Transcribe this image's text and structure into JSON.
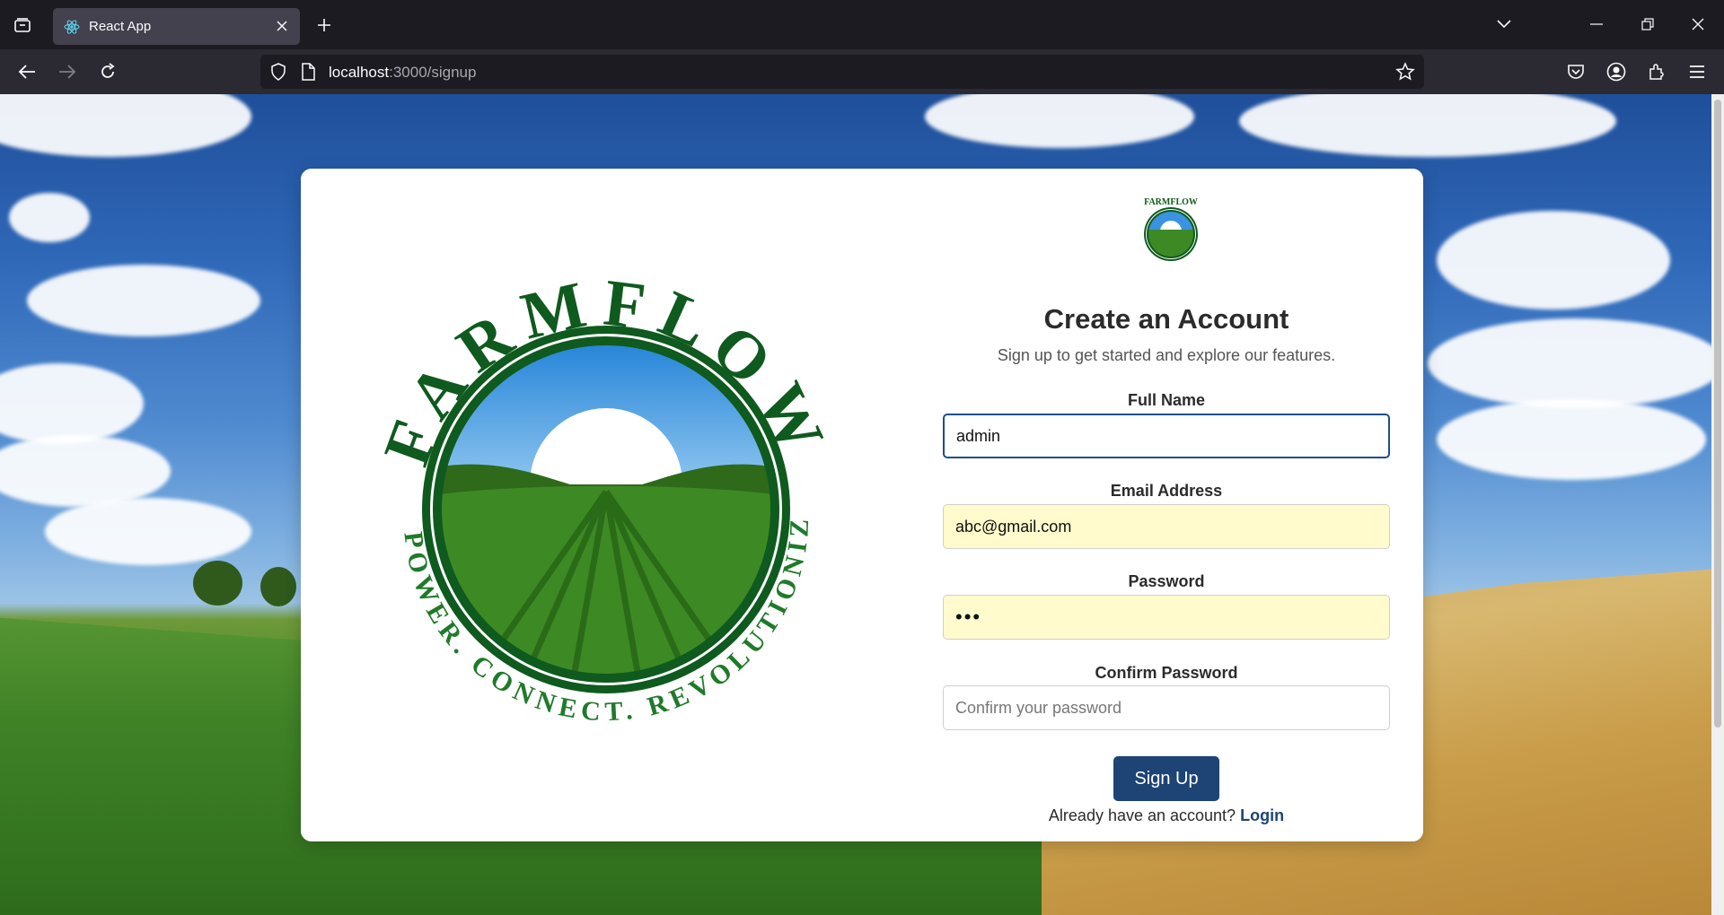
{
  "browser": {
    "tab_title": "React App",
    "url_host": "localhost",
    "url_rest": ":3000/signup",
    "icons": [
      "tab-list-icon",
      "react-favicon-icon",
      "close-icon",
      "plus-icon",
      "chevron-down-icon",
      "minimize-icon",
      "restore-icon",
      "close-window-icon",
      "back-icon",
      "forward-icon",
      "reload-icon",
      "shield-icon",
      "page-icon",
      "star-icon",
      "pocket-icon",
      "account-icon",
      "extensions-icon",
      "menu-icon"
    ]
  },
  "logo": {
    "brand": "FARMFLOW",
    "tagline": "EMPOWER. CONNECT. REVOLUTIONIZE."
  },
  "form": {
    "title": "Create an Account",
    "subtitle": "Sign up to get started and explore our features.",
    "full_name_label": "Full Name",
    "full_name_value": "admin",
    "email_label": "Email Address",
    "email_value": "abc@gmail.com",
    "password_label": "Password",
    "password_value": "•••",
    "confirm_label": "Confirm Password",
    "confirm_placeholder": "Confirm your password",
    "submit_label": "Sign Up",
    "login_prompt": "Already have an account?",
    "login_link": "Login"
  },
  "colors": {
    "primary": "#1d4474",
    "autofill": "#fffbcc",
    "logo_green": "#0f5a1e"
  }
}
